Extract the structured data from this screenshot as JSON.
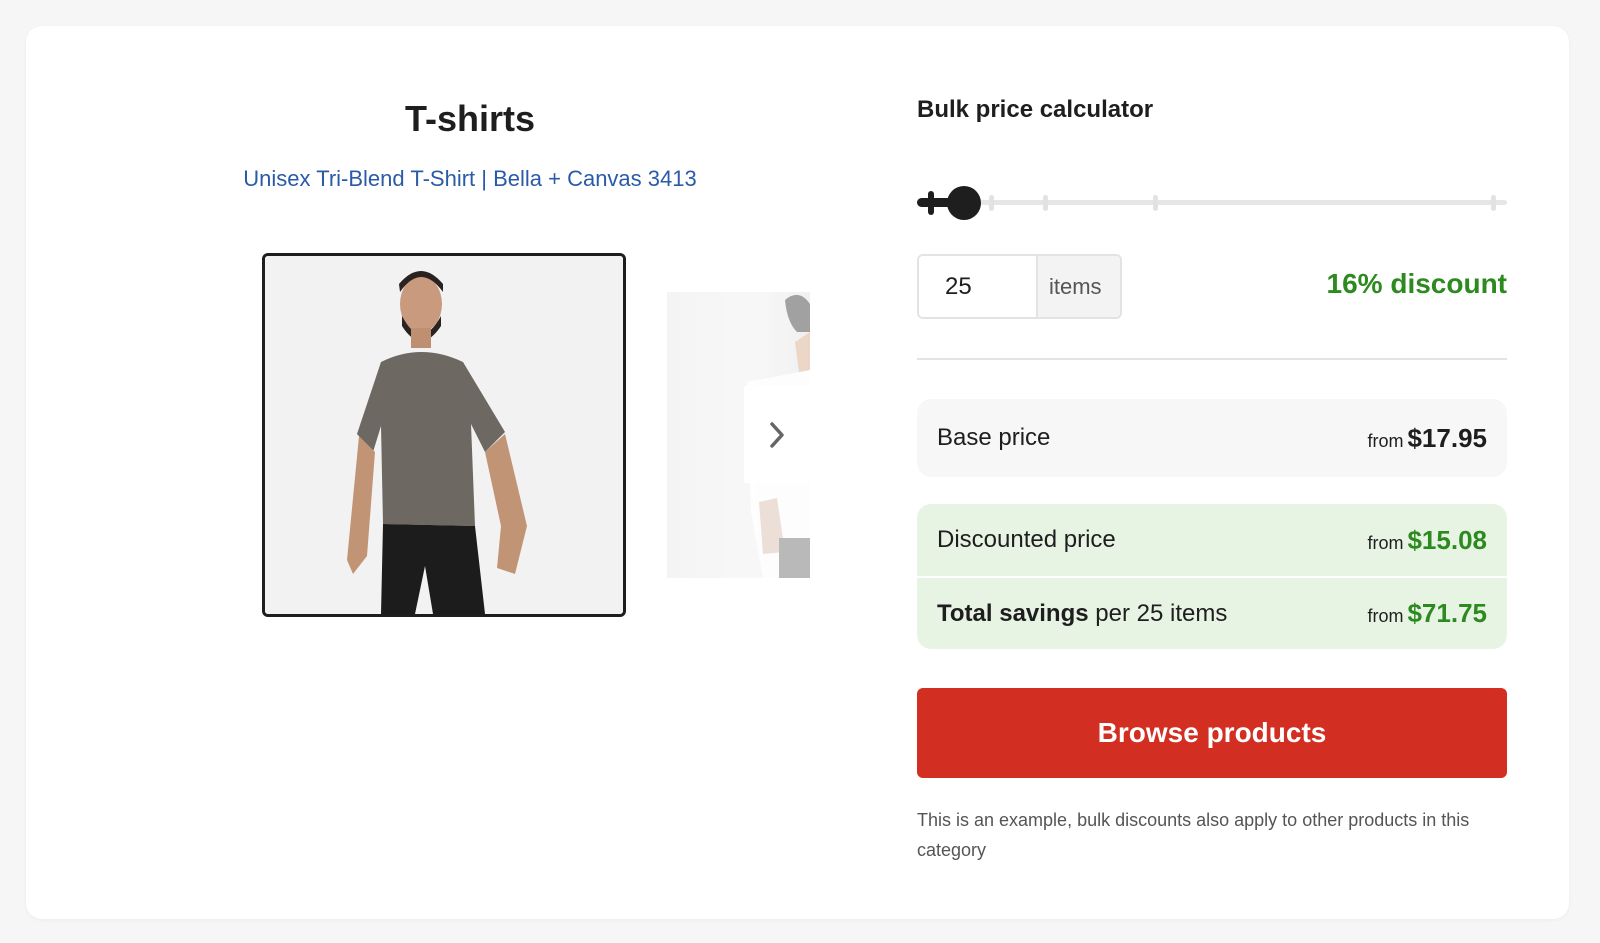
{
  "product": {
    "title": "T-shirts",
    "link_text": "Unisex Tri-Blend T-Shirt | Bella + Canvas 3413"
  },
  "calculator": {
    "title": "Bulk price calculator",
    "slider": {
      "value": 25,
      "min": 1,
      "max": 500,
      "fraction": 0.045
    },
    "quantity": "25",
    "unit": "items",
    "discount_label": "16% discount"
  },
  "prices": {
    "base": {
      "label": "Base price",
      "prefix": "from",
      "amount": "$17.95"
    },
    "discounted": {
      "label": "Discounted price",
      "prefix": "from",
      "amount": "$15.08"
    },
    "savings": {
      "label_bold": "Total savings",
      "label_rest": "per 25 items",
      "prefix": "from",
      "amount": "$71.75"
    }
  },
  "cta": {
    "label": "Browse products"
  },
  "note": "This is an example, bulk discounts also apply to other products in this category",
  "colors": {
    "accent_green": "#2d8a1f",
    "cta_red": "#d22e21",
    "link_blue": "#2b5ba7"
  },
  "icons": [
    "plus-icon",
    "chevron-right-icon"
  ]
}
